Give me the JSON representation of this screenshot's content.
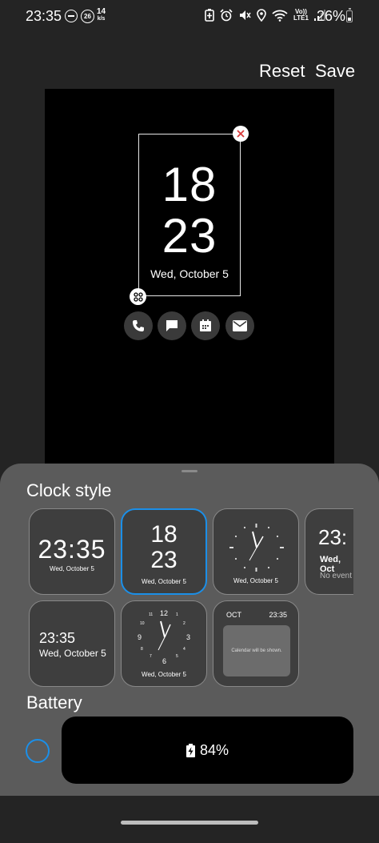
{
  "status_bar": {
    "time": "23:35",
    "badge_number": "26",
    "speed_value": "14",
    "speed_unit": "k/s",
    "lte_top": "Vo))",
    "lte_bottom": "LTE1",
    "battery_percent": "26%"
  },
  "header": {
    "reset_label": "Reset",
    "save_label": "Save"
  },
  "preview": {
    "hour": "18",
    "minute": "23",
    "date": "Wed, October 5",
    "shortcuts": [
      "phone-icon",
      "message-icon",
      "calendar-icon",
      "email-icon"
    ]
  },
  "clock_style": {
    "title": "Clock style",
    "cards": [
      {
        "time": "23:35",
        "date": "Wed, October 5"
      },
      {
        "hour": "18",
        "minute": "23",
        "date": "Wed, October 5"
      },
      {
        "date": "Wed, October 5"
      },
      {
        "time": "23:",
        "date": "Wed, Oct",
        "note": "No event"
      },
      {
        "time": "23:35",
        "date": "Wed, October 5"
      },
      {
        "n12": "12",
        "n3": "3",
        "n6": "6",
        "n9": "9",
        "n10": "10",
        "n11": "11",
        "n1": "1",
        "n2": "2",
        "n4": "4",
        "n5": "5",
        "n7": "7",
        "n8": "8",
        "date": "Wed, October 5"
      },
      {
        "month": "OCT",
        "time": "23:35",
        "calendar_note": "Calendar will be shown."
      }
    ],
    "selected_index": 1
  },
  "battery": {
    "title": "Battery",
    "value": "84%"
  },
  "colors": {
    "accent": "#1b8fe8",
    "sheet_bg": "#5b5b5b",
    "close_red": "#d93a3a"
  }
}
